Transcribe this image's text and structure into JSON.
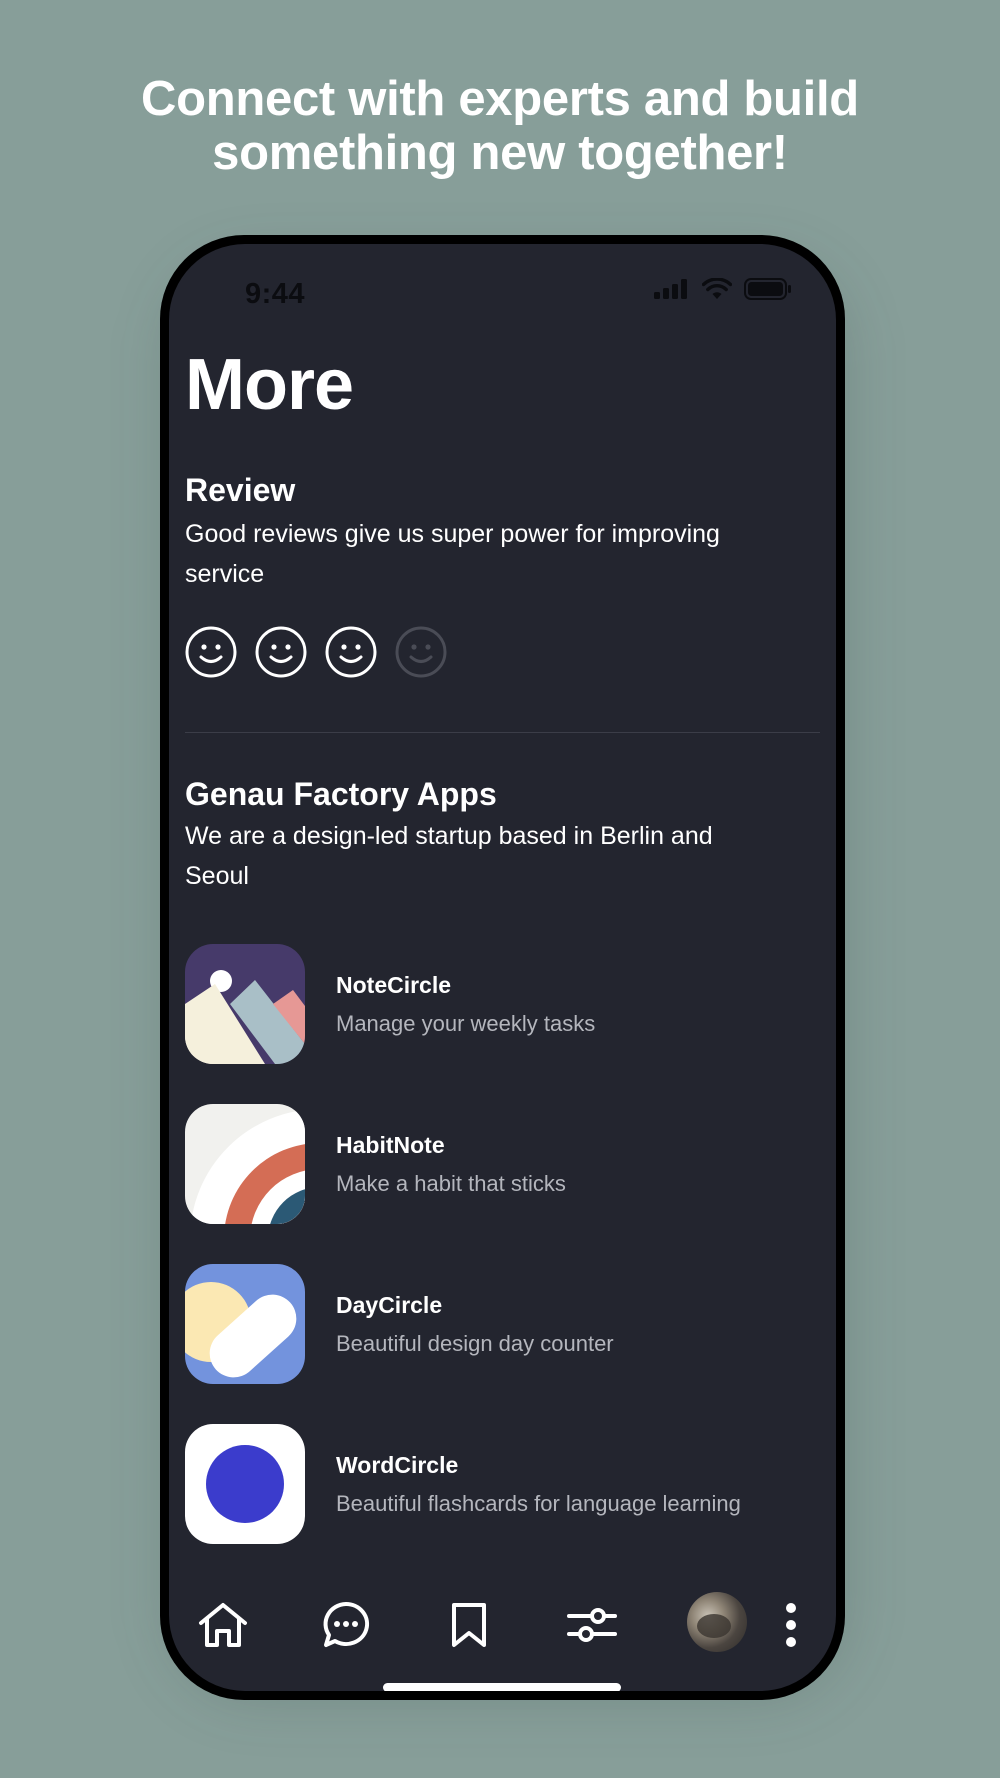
{
  "headline": {
    "line1": "Connect with experts and build",
    "line2": "something new together!"
  },
  "status_bar": {
    "time": "9:44",
    "icons": [
      "signal-icon",
      "wifi-icon",
      "battery-icon"
    ]
  },
  "page": {
    "title": "More"
  },
  "review": {
    "title": "Review",
    "text": "Good reviews give us super power for improving service",
    "rating": 3,
    "max_rating": 4
  },
  "company": {
    "title": "Genau Factory Apps",
    "text": "We are a design-led startup based in Berlin and Seoul"
  },
  "apps": [
    {
      "name": "NoteCircle",
      "desc": "Manage your weekly tasks"
    },
    {
      "name": "HabitNote",
      "desc": "Make a habit that sticks"
    },
    {
      "name": "DayCircle",
      "desc": "Beautiful design day counter"
    },
    {
      "name": "WordCircle",
      "desc": "Beautiful flashcards for language learning"
    }
  ],
  "tab_bar": {
    "items": [
      "home-icon",
      "chat-icon",
      "bookmark-icon",
      "sliders-icon",
      "avatar",
      "more-vertical-icon"
    ]
  },
  "colors": {
    "background": "#879e99",
    "screen": "#23252f",
    "wordcircle_dot": "#3b3ccc",
    "daycircle_bg": "#7393dd",
    "habitnote_orange": "#d46d55",
    "notecircle_purple": "#463a6a"
  }
}
